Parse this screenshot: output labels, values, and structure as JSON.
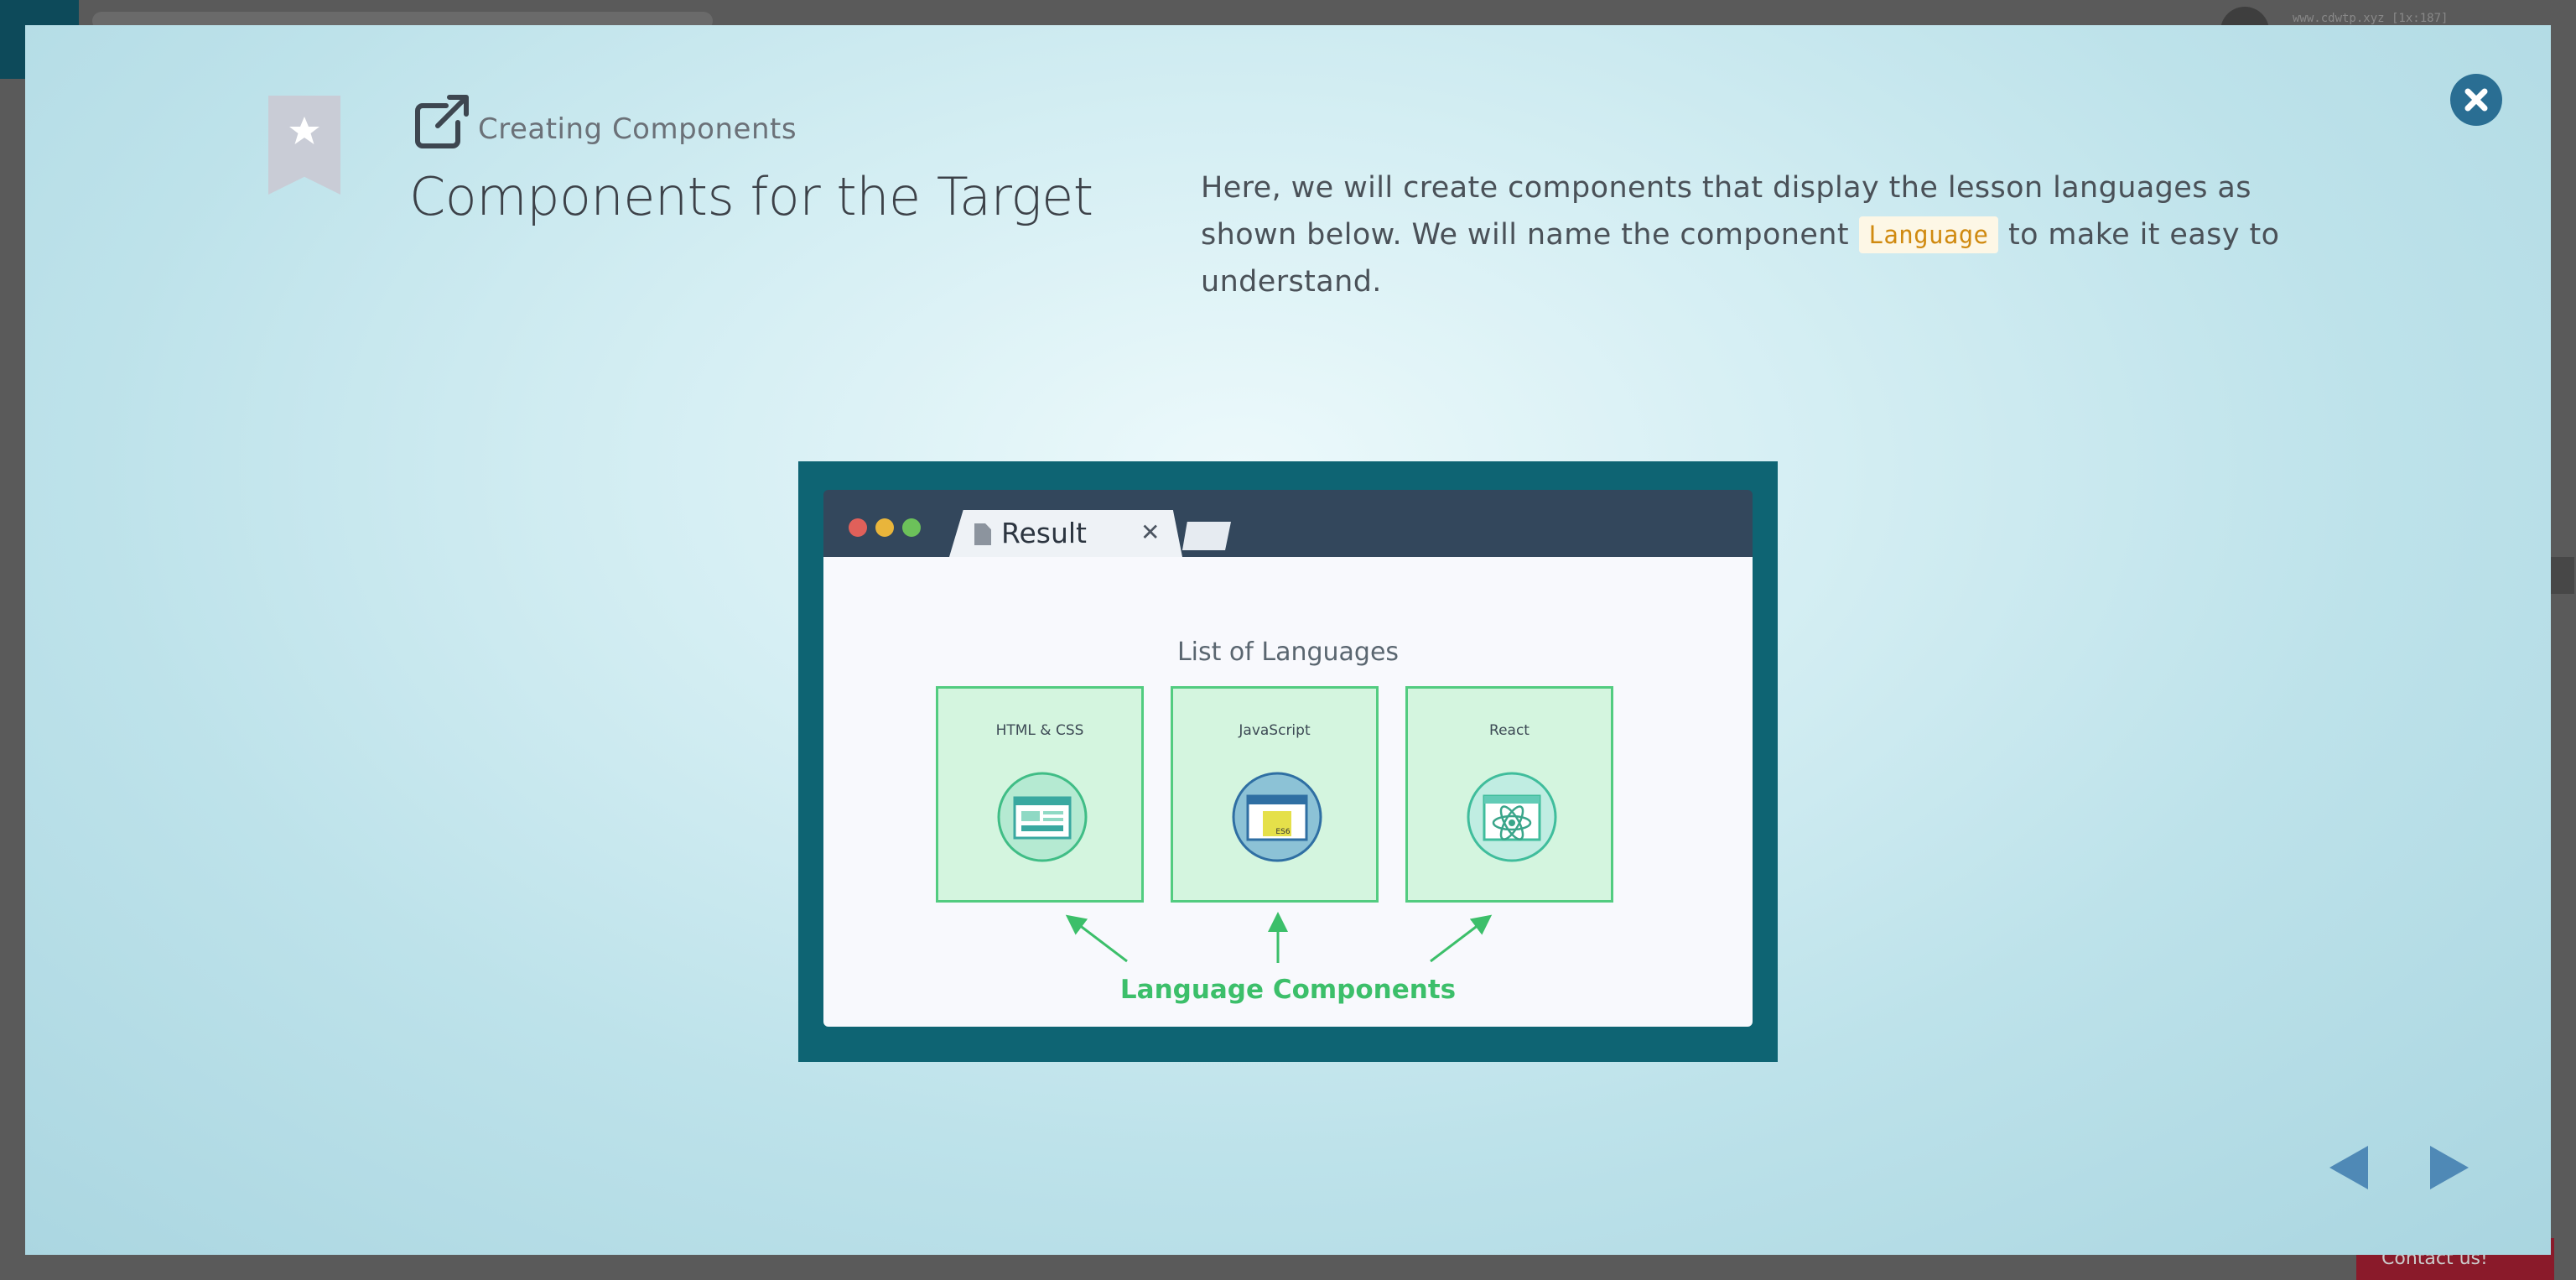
{
  "background": {
    "url_fragment": "www.cdwtp.xyz [1x:187]",
    "contact_label": "Contact us!"
  },
  "modal": {
    "subtitle": "Creating Components",
    "title": "Components for the Target",
    "description": {
      "before": "Here, we will create components that display the lesson languages as shown below. We will name the component ",
      "code": "Language",
      "after": " to make it easy to understand."
    },
    "close_icon": "close-circle-icon",
    "bookmark_icon": "bookmark-star-icon",
    "subtitle_icon": "external-link-icon"
  },
  "illustration": {
    "tab_label": "Result",
    "tab_close": "✕",
    "list_title": "List of Languages",
    "cards": [
      {
        "label": "HTML & CSS",
        "icon": "html-css-icon"
      },
      {
        "label": "JavaScript",
        "icon": "javascript-es6-icon",
        "badge": "ES6"
      },
      {
        "label": "React",
        "icon": "react-atom-icon"
      }
    ],
    "caption": "Language Components"
  },
  "navigation": {
    "prev_icon": "triangle-left-icon",
    "next_icon": "triangle-right-icon"
  },
  "colors": {
    "accent": "#2a6e93",
    "code_text": "#d08a10",
    "component_green": "#3cbf6a",
    "frame": "#0e6473"
  }
}
